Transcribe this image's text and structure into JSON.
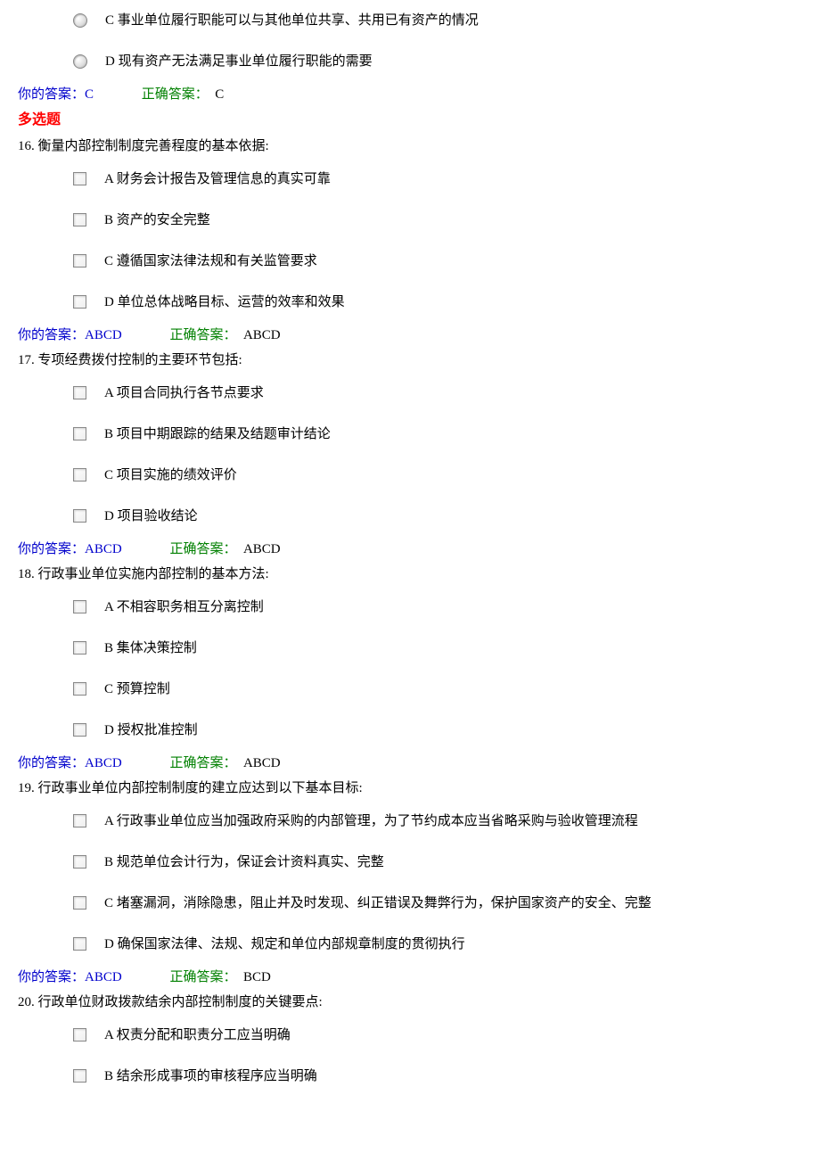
{
  "prev_question": {
    "options": [
      {
        "letter": "C",
        "text": "事业单位履行职能可以与其他单位共享、共用已有资产的情况"
      },
      {
        "letter": "D",
        "text": "现有资产无法满足事业单位履行职能的需要"
      }
    ],
    "your_label": "你的答案：",
    "your_value": "C",
    "correct_label": "正确答案：",
    "correct_value": "C"
  },
  "section_header": "多选题",
  "questions": [
    {
      "num": "16.",
      "stem": "衡量内部控制制度完善程度的基本依据:",
      "options": [
        {
          "letter": "A",
          "text": "财务会计报告及管理信息的真实可靠"
        },
        {
          "letter": "B",
          "text": "资产的安全完整"
        },
        {
          "letter": "C",
          "text": "遵循国家法律法规和有关监管要求"
        },
        {
          "letter": "D",
          "text": "单位总体战略目标、运营的效率和效果"
        }
      ],
      "your_label": "你的答案：",
      "your_value": "ABCD",
      "correct_label": "正确答案：",
      "correct_value": "ABCD"
    },
    {
      "num": "17.",
      "stem": "专项经费拨付控制的主要环节包括:",
      "options": [
        {
          "letter": "A",
          "text": "项目合同执行各节点要求"
        },
        {
          "letter": "B",
          "text": "项目中期跟踪的结果及结题审计结论"
        },
        {
          "letter": "C",
          "text": "项目实施的绩效评价"
        },
        {
          "letter": "D",
          "text": "项目验收结论"
        }
      ],
      "your_label": "你的答案：",
      "your_value": "ABCD",
      "correct_label": "正确答案：",
      "correct_value": "ABCD"
    },
    {
      "num": "18.",
      "stem": "行政事业单位实施内部控制的基本方法:",
      "options": [
        {
          "letter": "A",
          "text": "不相容职务相互分离控制"
        },
        {
          "letter": "B",
          "text": "集体决策控制"
        },
        {
          "letter": "C",
          "text": "预算控制"
        },
        {
          "letter": "D",
          "text": "授权批准控制"
        }
      ],
      "your_label": "你的答案：",
      "your_value": "ABCD",
      "correct_label": "正确答案：",
      "correct_value": "ABCD"
    },
    {
      "num": "19.",
      "stem": "行政事业单位内部控制制度的建立应达到以下基本目标:",
      "options": [
        {
          "letter": "A",
          "text": "行政事业单位应当加强政府采购的内部管理，为了节约成本应当省略采购与验收管理流程"
        },
        {
          "letter": "B",
          "text": "规范单位会计行为，保证会计资料真实、完整"
        },
        {
          "letter": "C",
          "text": "堵塞漏洞，消除隐患，阻止并及时发现、纠正错误及舞弊行为，保护国家资产的安全、完整"
        },
        {
          "letter": "D",
          "text": "确保国家法律、法规、规定和单位内部规章制度的贯彻执行"
        }
      ],
      "your_label": "你的答案：",
      "your_value": "ABCD",
      "correct_label": "正确答案：",
      "correct_value": "BCD"
    },
    {
      "num": "20.",
      "stem": "行政单位财政拨款结余内部控制制度的关键要点:",
      "options": [
        {
          "letter": "A",
          "text": "权责分配和职责分工应当明确"
        },
        {
          "letter": "B",
          "text": "结余形成事项的审核程序应当明确"
        }
      ]
    }
  ]
}
